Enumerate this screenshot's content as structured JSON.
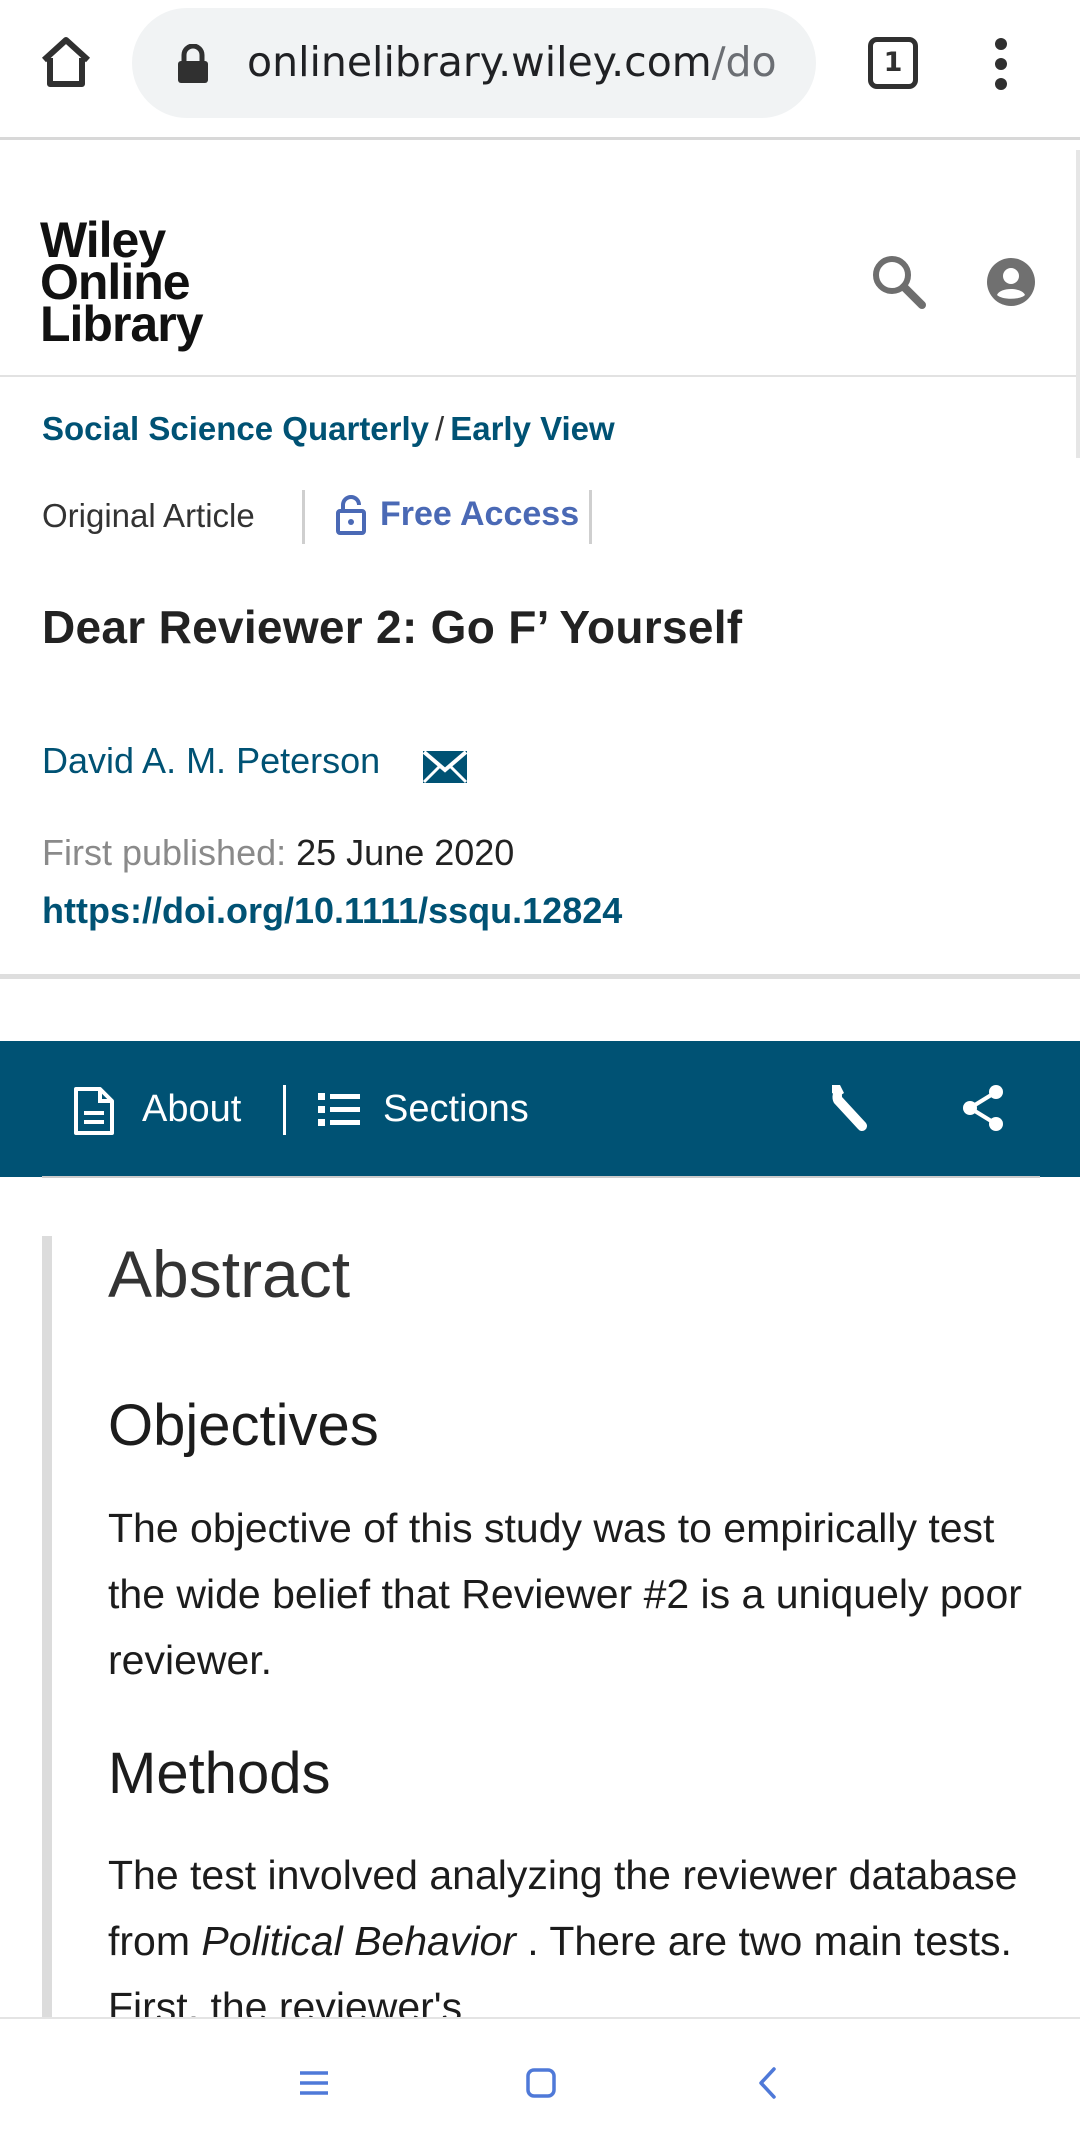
{
  "browser": {
    "url_host": "onlinelibrary.wiley.com",
    "url_path": "/do",
    "tab_count": "1"
  },
  "site": {
    "logo_lines": [
      "Wiley",
      "Online",
      "Library"
    ]
  },
  "article": {
    "journal": "Social Science Quarterly",
    "breadcrumb_sep": "/",
    "issue": "Early View",
    "type": "Original Article",
    "access": "Free Access",
    "title": "Dear Reviewer 2: Go F’ Yourself",
    "author": "David A. M. Peterson",
    "published_label": "First published:",
    "published_date": "25 June 2020",
    "doi": "https://doi.org/10.1111/ssqu.12824"
  },
  "toolbar": {
    "about_label": "About",
    "sections_label": "Sections",
    "color": "#005274"
  },
  "abstract": {
    "heading": "Abstract",
    "objectives_heading": "Objectives",
    "objectives_text": "The objective of this study was to empirically test the wide belief that Reviewer #2 is a uniquely poor reviewer.",
    "methods_heading": "Methods",
    "methods_text_before": "The test involved analyzing the reviewer database from ",
    "methods_text_italic": "Political Behavior",
    "methods_text_after": " . There are two main tests. First, the reviewer's"
  },
  "icons": {
    "home": "home-icon",
    "lock": "lock-icon",
    "tabs": "tab-switcher-icon",
    "menu": "more-vert-icon",
    "search": "search-icon",
    "account": "account-icon",
    "unlock": "unlock-icon",
    "mail": "mail-icon",
    "about": "document-icon",
    "sections": "list-icon",
    "tools": "wrench-icon",
    "share": "share-icon",
    "nav_recents": "recents-icon",
    "nav_home": "home-square-icon",
    "nav_back": "back-icon"
  },
  "colors": {
    "link": "#005274",
    "free_access": "#4a69b5",
    "nav_icons": "#4f79d8"
  }
}
